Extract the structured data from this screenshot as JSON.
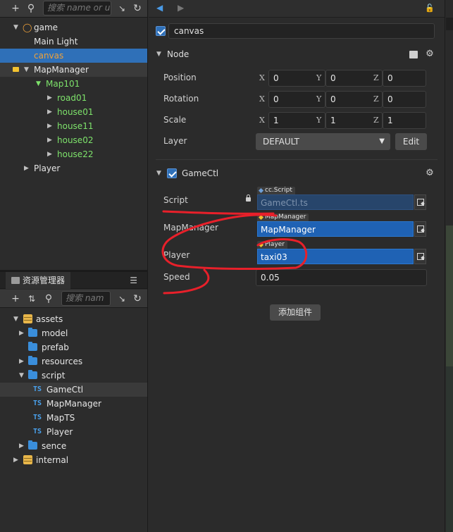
{
  "hierarchy": {
    "search_placeholder": "搜索 name or u",
    "items": [
      {
        "label": "game",
        "arrow": "▼"
      },
      {
        "label": "Main Light"
      },
      {
        "label": "canvas"
      },
      {
        "label": "MapManager",
        "arrow": "▼"
      },
      {
        "label": "Map101",
        "arrow": "▼"
      },
      {
        "label": "road01",
        "arrow": "▶"
      },
      {
        "label": "house01",
        "arrow": "▶"
      },
      {
        "label": "house11",
        "arrow": "▶"
      },
      {
        "label": "house02",
        "arrow": "▶"
      },
      {
        "label": "house22",
        "arrow": "▶"
      },
      {
        "label": "Player",
        "arrow": "▶"
      }
    ]
  },
  "assets": {
    "tab_label": "资源管理器",
    "search_placeholder": "搜索 nam",
    "items": [
      {
        "label": "assets",
        "arrow": "▼"
      },
      {
        "label": "model",
        "arrow": "▶"
      },
      {
        "label": "prefab"
      },
      {
        "label": "resources",
        "arrow": "▶"
      },
      {
        "label": "script",
        "arrow": "▼"
      },
      {
        "label": "GameCtl",
        "badge": "TS"
      },
      {
        "label": "MapManager",
        "badge": "TS"
      },
      {
        "label": "MapTS",
        "badge": "TS"
      },
      {
        "label": "Player",
        "badge": "TS"
      },
      {
        "label": "sence",
        "arrow": "▶"
      },
      {
        "label": "internal",
        "arrow": "▶"
      }
    ]
  },
  "inspector": {
    "node_name": "canvas",
    "node_section": {
      "title": "Node",
      "position": {
        "label": "Position",
        "x": "0",
        "y": "0",
        "z": "0"
      },
      "rotation": {
        "label": "Rotation",
        "x": "0",
        "y": "0",
        "z": "0"
      },
      "scale": {
        "label": "Scale",
        "x": "1",
        "y": "1",
        "z": "1"
      },
      "layer": {
        "label": "Layer",
        "value": "DEFAULT",
        "edit": "Edit"
      },
      "axis": {
        "x": "X",
        "y": "Y",
        "z": "Z"
      }
    },
    "component": {
      "title": "GameCtl",
      "script": {
        "label": "Script",
        "tag": "cc.Script",
        "value": "GameCtl.ts"
      },
      "map_manager": {
        "label": "MapManager",
        "tag": "MapManager",
        "value": "MapManager"
      },
      "player": {
        "label": "Player",
        "tag": "Player",
        "value": "taxi03"
      },
      "speed": {
        "label": "Speed",
        "value": "0.05"
      }
    },
    "add_component": "添加组件"
  },
  "colors": {
    "selection": "#2f70b8",
    "green_node": "#7ee36b",
    "annotation": "#e8202a"
  }
}
